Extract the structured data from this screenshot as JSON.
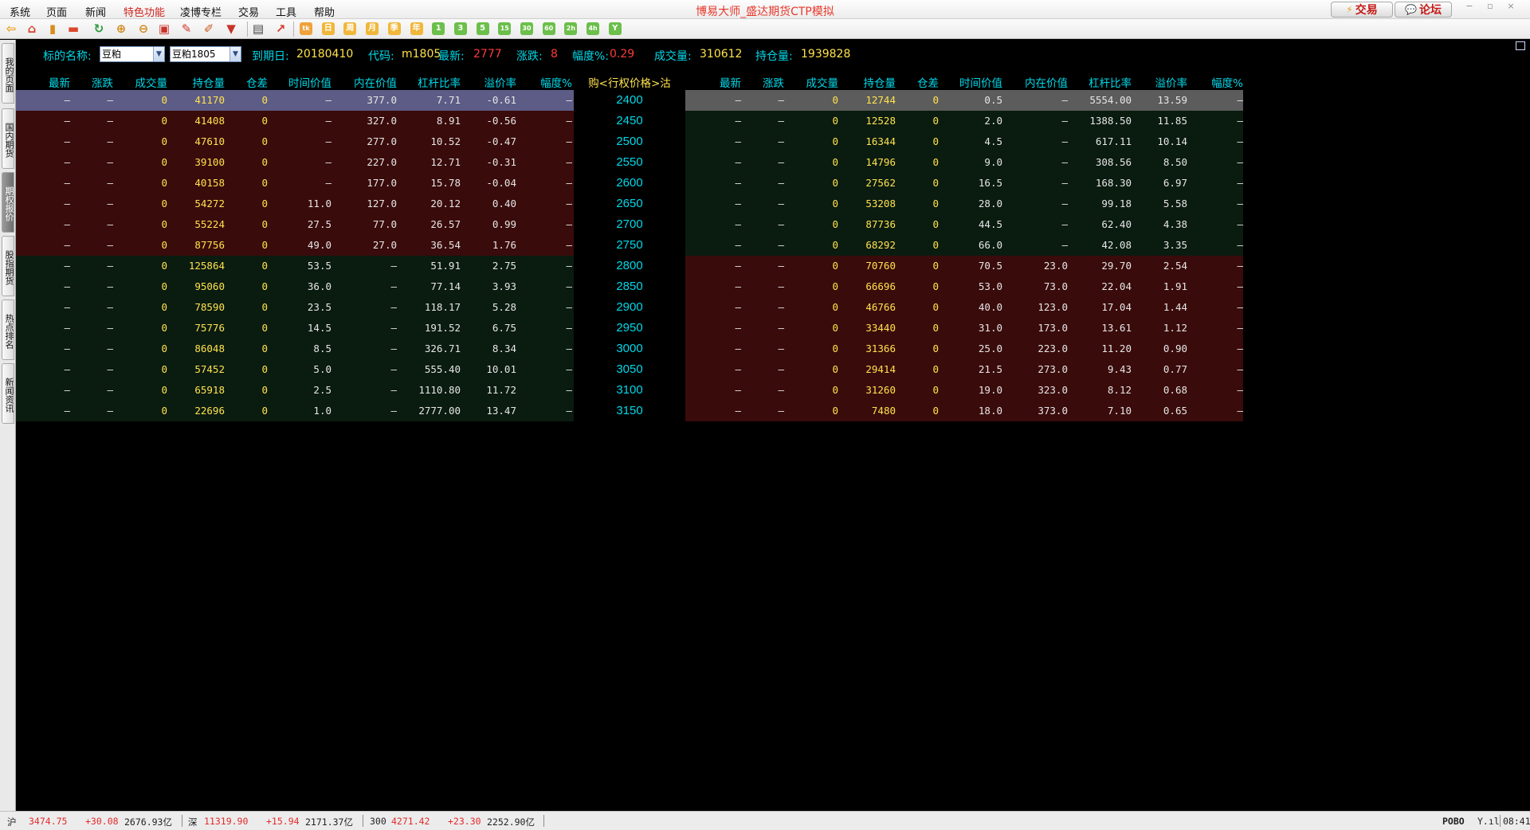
{
  "menubar": {
    "items": [
      {
        "label": "系统",
        "special": false
      },
      {
        "label": "页面",
        "special": false
      },
      {
        "label": "新闻",
        "special": false
      },
      {
        "label": "特色功能",
        "special": true
      },
      {
        "label": "凌博专栏",
        "special": false
      },
      {
        "label": "交易",
        "special": false
      },
      {
        "label": "工具",
        "special": false
      },
      {
        "label": "帮助",
        "special": false
      }
    ],
    "title": "博易大师_盛达期货CTP模拟",
    "trade_btn": "交易",
    "forum_btn": "论坛",
    "window_controls": [
      "−",
      "▫",
      "×"
    ]
  },
  "toolbar": {
    "buttons": [
      {
        "name": "back-arrow-icon",
        "glyph": "⇦",
        "color": "#e8a21b"
      },
      {
        "name": "home-icon",
        "glyph": "⌂",
        "color": "#d6402e"
      },
      {
        "name": "book-icon",
        "glyph": "▮",
        "color": "#d98c1e"
      },
      {
        "name": "card-icon",
        "glyph": "▬",
        "color": "#d9482c"
      },
      {
        "name": "refresh-icon",
        "glyph": "↻",
        "color": "#2e9a3d"
      },
      {
        "name": "zoom-in-icon",
        "glyph": "⊕",
        "color": "#d08a1d"
      },
      {
        "name": "zoom-out-icon",
        "glyph": "⊖",
        "color": "#d08a1d"
      },
      {
        "name": "window-icon",
        "glyph": "▣",
        "color": "#c9332a"
      },
      {
        "name": "pen-icon",
        "glyph": "✎",
        "color": "#d4372a"
      },
      {
        "name": "paint-icon",
        "glyph": "✐",
        "color": "#cc5a1f"
      },
      {
        "name": "filter-icon",
        "glyph": "▼",
        "color": "#c83228"
      },
      {
        "name": "table-icon",
        "glyph": "▤",
        "color": "#444444"
      },
      {
        "name": "chart-icon",
        "glyph": "↗",
        "color": "#d33c2e"
      }
    ],
    "period_buttons": [
      {
        "name": "tick-chart-button",
        "text": "tk",
        "color": "#f0a23a"
      },
      {
        "name": "day-chart-button",
        "text": "日",
        "color": "#f0b73a"
      },
      {
        "name": "week-chart-button",
        "text": "周",
        "color": "#f0b73a"
      },
      {
        "name": "month-chart-button",
        "text": "月",
        "color": "#f0b73a"
      },
      {
        "name": "season-chart-button",
        "text": "季",
        "color": "#f0b73a"
      },
      {
        "name": "year-chart-button",
        "text": "年",
        "color": "#f0b73a"
      },
      {
        "name": "1min-chart-button",
        "text": "1",
        "color": "#6bbf4a"
      },
      {
        "name": "3min-chart-button",
        "text": "3",
        "color": "#6bbf4a"
      },
      {
        "name": "5min-chart-button",
        "text": "5",
        "color": "#6bbf4a"
      },
      {
        "name": "15min-chart-button",
        "text": "15",
        "color": "#6bbf4a"
      },
      {
        "name": "30min-chart-button",
        "text": "30",
        "color": "#6bbf4a"
      },
      {
        "name": "60min-chart-button",
        "text": "60",
        "color": "#6bbf4a"
      },
      {
        "name": "2h-chart-button",
        "text": "2h",
        "color": "#6bbf4a"
      },
      {
        "name": "4h-chart-button",
        "text": "4h",
        "color": "#6bbf4a"
      },
      {
        "name": "y-chart-button",
        "text": "Y",
        "color": "#6bbf4a"
      }
    ]
  },
  "left_tabs": [
    {
      "label": "我的页面",
      "active": false
    },
    {
      "label": "国内期货",
      "active": false
    },
    {
      "label": "期权报价",
      "active": true
    },
    {
      "label": "股指期货",
      "active": false
    },
    {
      "label": "热点排名",
      "active": false
    },
    {
      "label": "新闻资讯",
      "active": false
    }
  ],
  "infobar": {
    "underlying_label": "标的名称:",
    "underlying_value": "豆粕",
    "contract_value": "豆粕1805",
    "expiry_label": "到期日:",
    "expiry_value": "20180410",
    "code_label": "代码:",
    "code_value": "m1805",
    "last_label": "最新:",
    "last_value": "2777",
    "change_label": "涨跌:",
    "change_value": "8",
    "pct_label": "幅度%:",
    "pct_value": "0.29",
    "volume_label": "成交量:",
    "volume_value": "310612",
    "oi_label": "持仓量:",
    "oi_value": "1939828"
  },
  "table": {
    "call_headers": [
      "最新",
      "涨跌",
      "成交量",
      "持仓量",
      "仓差",
      "时间价值",
      "内在价值",
      "杠杆比率",
      "溢价率",
      "幅度%"
    ],
    "strike_header": "购<行权价格>沽",
    "put_headers": [
      "最新",
      "涨跌",
      "成交量",
      "持仓量",
      "仓差",
      "时间价值",
      "内在价值",
      "杠杆比率",
      "溢价率",
      "幅度%"
    ],
    "rows": [
      {
        "strike": "2400",
        "itm": "call",
        "selected": true,
        "call": [
          "—",
          "—",
          "0",
          "41170",
          "0",
          "—",
          "377.0",
          "7.71",
          "-0.61",
          "—"
        ],
        "put": [
          "—",
          "—",
          "0",
          "12744",
          "0",
          "0.5",
          "—",
          "5554.00",
          "13.59",
          "—"
        ]
      },
      {
        "strike": "2450",
        "itm": "call",
        "selected": false,
        "call": [
          "—",
          "—",
          "0",
          "41408",
          "0",
          "—",
          "327.0",
          "8.91",
          "-0.56",
          "—"
        ],
        "put": [
          "—",
          "—",
          "0",
          "12528",
          "0",
          "2.0",
          "—",
          "1388.50",
          "11.85",
          "—"
        ]
      },
      {
        "strike": "2500",
        "itm": "call",
        "selected": false,
        "call": [
          "—",
          "—",
          "0",
          "47610",
          "0",
          "—",
          "277.0",
          "10.52",
          "-0.47",
          "—"
        ],
        "put": [
          "—",
          "—",
          "0",
          "16344",
          "0",
          "4.5",
          "—",
          "617.11",
          "10.14",
          "—"
        ]
      },
      {
        "strike": "2550",
        "itm": "call",
        "selected": false,
        "call": [
          "—",
          "—",
          "0",
          "39100",
          "0",
          "—",
          "227.0",
          "12.71",
          "-0.31",
          "—"
        ],
        "put": [
          "—",
          "—",
          "0",
          "14796",
          "0",
          "9.0",
          "—",
          "308.56",
          "8.50",
          "—"
        ]
      },
      {
        "strike": "2600",
        "itm": "call",
        "selected": false,
        "call": [
          "—",
          "—",
          "0",
          "40158",
          "0",
          "—",
          "177.0",
          "15.78",
          "-0.04",
          "—"
        ],
        "put": [
          "—",
          "—",
          "0",
          "27562",
          "0",
          "16.5",
          "—",
          "168.30",
          "6.97",
          "—"
        ]
      },
      {
        "strike": "2650",
        "itm": "call",
        "selected": false,
        "call": [
          "—",
          "—",
          "0",
          "54272",
          "0",
          "11.0",
          "127.0",
          "20.12",
          "0.40",
          "—"
        ],
        "put": [
          "—",
          "—",
          "0",
          "53208",
          "0",
          "28.0",
          "—",
          "99.18",
          "5.58",
          "—"
        ]
      },
      {
        "strike": "2700",
        "itm": "call",
        "selected": false,
        "call": [
          "—",
          "—",
          "0",
          "55224",
          "0",
          "27.5",
          "77.0",
          "26.57",
          "0.99",
          "—"
        ],
        "put": [
          "—",
          "—",
          "0",
          "87736",
          "0",
          "44.5",
          "—",
          "62.40",
          "4.38",
          "—"
        ]
      },
      {
        "strike": "2750",
        "itm": "call",
        "selected": false,
        "call": [
          "—",
          "—",
          "0",
          "87756",
          "0",
          "49.0",
          "27.0",
          "36.54",
          "1.76",
          "—"
        ],
        "put": [
          "—",
          "—",
          "0",
          "68292",
          "0",
          "66.0",
          "—",
          "42.08",
          "3.35",
          "—"
        ]
      },
      {
        "strike": "2800",
        "itm": "put",
        "selected": false,
        "call": [
          "—",
          "—",
          "0",
          "125864",
          "0",
          "53.5",
          "—",
          "51.91",
          "2.75",
          "—"
        ],
        "put": [
          "—",
          "—",
          "0",
          "70760",
          "0",
          "70.5",
          "23.0",
          "29.70",
          "2.54",
          "—"
        ]
      },
      {
        "strike": "2850",
        "itm": "put",
        "selected": false,
        "call": [
          "—",
          "—",
          "0",
          "95060",
          "0",
          "36.0",
          "—",
          "77.14",
          "3.93",
          "—"
        ],
        "put": [
          "—",
          "—",
          "0",
          "66696",
          "0",
          "53.0",
          "73.0",
          "22.04",
          "1.91",
          "—"
        ]
      },
      {
        "strike": "2900",
        "itm": "put",
        "selected": false,
        "call": [
          "—",
          "—",
          "0",
          "78590",
          "0",
          "23.5",
          "—",
          "118.17",
          "5.28",
          "—"
        ],
        "put": [
          "—",
          "—",
          "0",
          "46766",
          "0",
          "40.0",
          "123.0",
          "17.04",
          "1.44",
          "—"
        ]
      },
      {
        "strike": "2950",
        "itm": "put",
        "selected": false,
        "call": [
          "—",
          "—",
          "0",
          "75776",
          "0",
          "14.5",
          "—",
          "191.52",
          "6.75",
          "—"
        ],
        "put": [
          "—",
          "—",
          "0",
          "33440",
          "0",
          "31.0",
          "173.0",
          "13.61",
          "1.12",
          "—"
        ]
      },
      {
        "strike": "3000",
        "itm": "put",
        "selected": false,
        "call": [
          "—",
          "—",
          "0",
          "86048",
          "0",
          "8.5",
          "—",
          "326.71",
          "8.34",
          "—"
        ],
        "put": [
          "—",
          "—",
          "0",
          "31366",
          "0",
          "25.0",
          "223.0",
          "11.20",
          "0.90",
          "—"
        ]
      },
      {
        "strike": "3050",
        "itm": "put",
        "selected": false,
        "call": [
          "—",
          "—",
          "0",
          "57452",
          "0",
          "5.0",
          "—",
          "555.40",
          "10.01",
          "—"
        ],
        "put": [
          "—",
          "—",
          "0",
          "29414",
          "0",
          "21.5",
          "273.0",
          "9.43",
          "0.77",
          "—"
        ]
      },
      {
        "strike": "3100",
        "itm": "put",
        "selected": false,
        "call": [
          "—",
          "—",
          "0",
          "65918",
          "0",
          "2.5",
          "—",
          "1110.80",
          "11.72",
          "—"
        ],
        "put": [
          "—",
          "—",
          "0",
          "31260",
          "0",
          "19.0",
          "323.0",
          "8.12",
          "0.68",
          "—"
        ]
      },
      {
        "strike": "3150",
        "itm": "put",
        "selected": false,
        "call": [
          "—",
          "—",
          "0",
          "22696",
          "0",
          "1.0",
          "—",
          "2777.00",
          "13.47",
          "—"
        ],
        "put": [
          "—",
          "—",
          "0",
          "7480",
          "0",
          "18.0",
          "373.0",
          "7.10",
          "0.65",
          "—"
        ]
      }
    ]
  },
  "statusbar": {
    "sh_label": "沪",
    "sh_value": "3474.75",
    "sh_change": "+30.08",
    "sh_amount": "2676.93亿",
    "sz_label": "深",
    "sz_value": "11319.90",
    "sz_change": "+15.94",
    "sz_amount": "2171.37亿",
    "hs300_label": "300",
    "hs300_value": "4271.42",
    "hs300_change": "+23.30",
    "hs300_amount": "2252.90亿",
    "brand": "POBO",
    "signal": "Y.ıl",
    "time": "08:41"
  },
  "colors": {
    "header": "#00d8e8",
    "yellow": "#ffe34d",
    "red": "#ff3a3a",
    "itm_bg": "#3a0b0b",
    "otm_bg": "#0a1b10",
    "selected_bg": "#5c5c86"
  }
}
